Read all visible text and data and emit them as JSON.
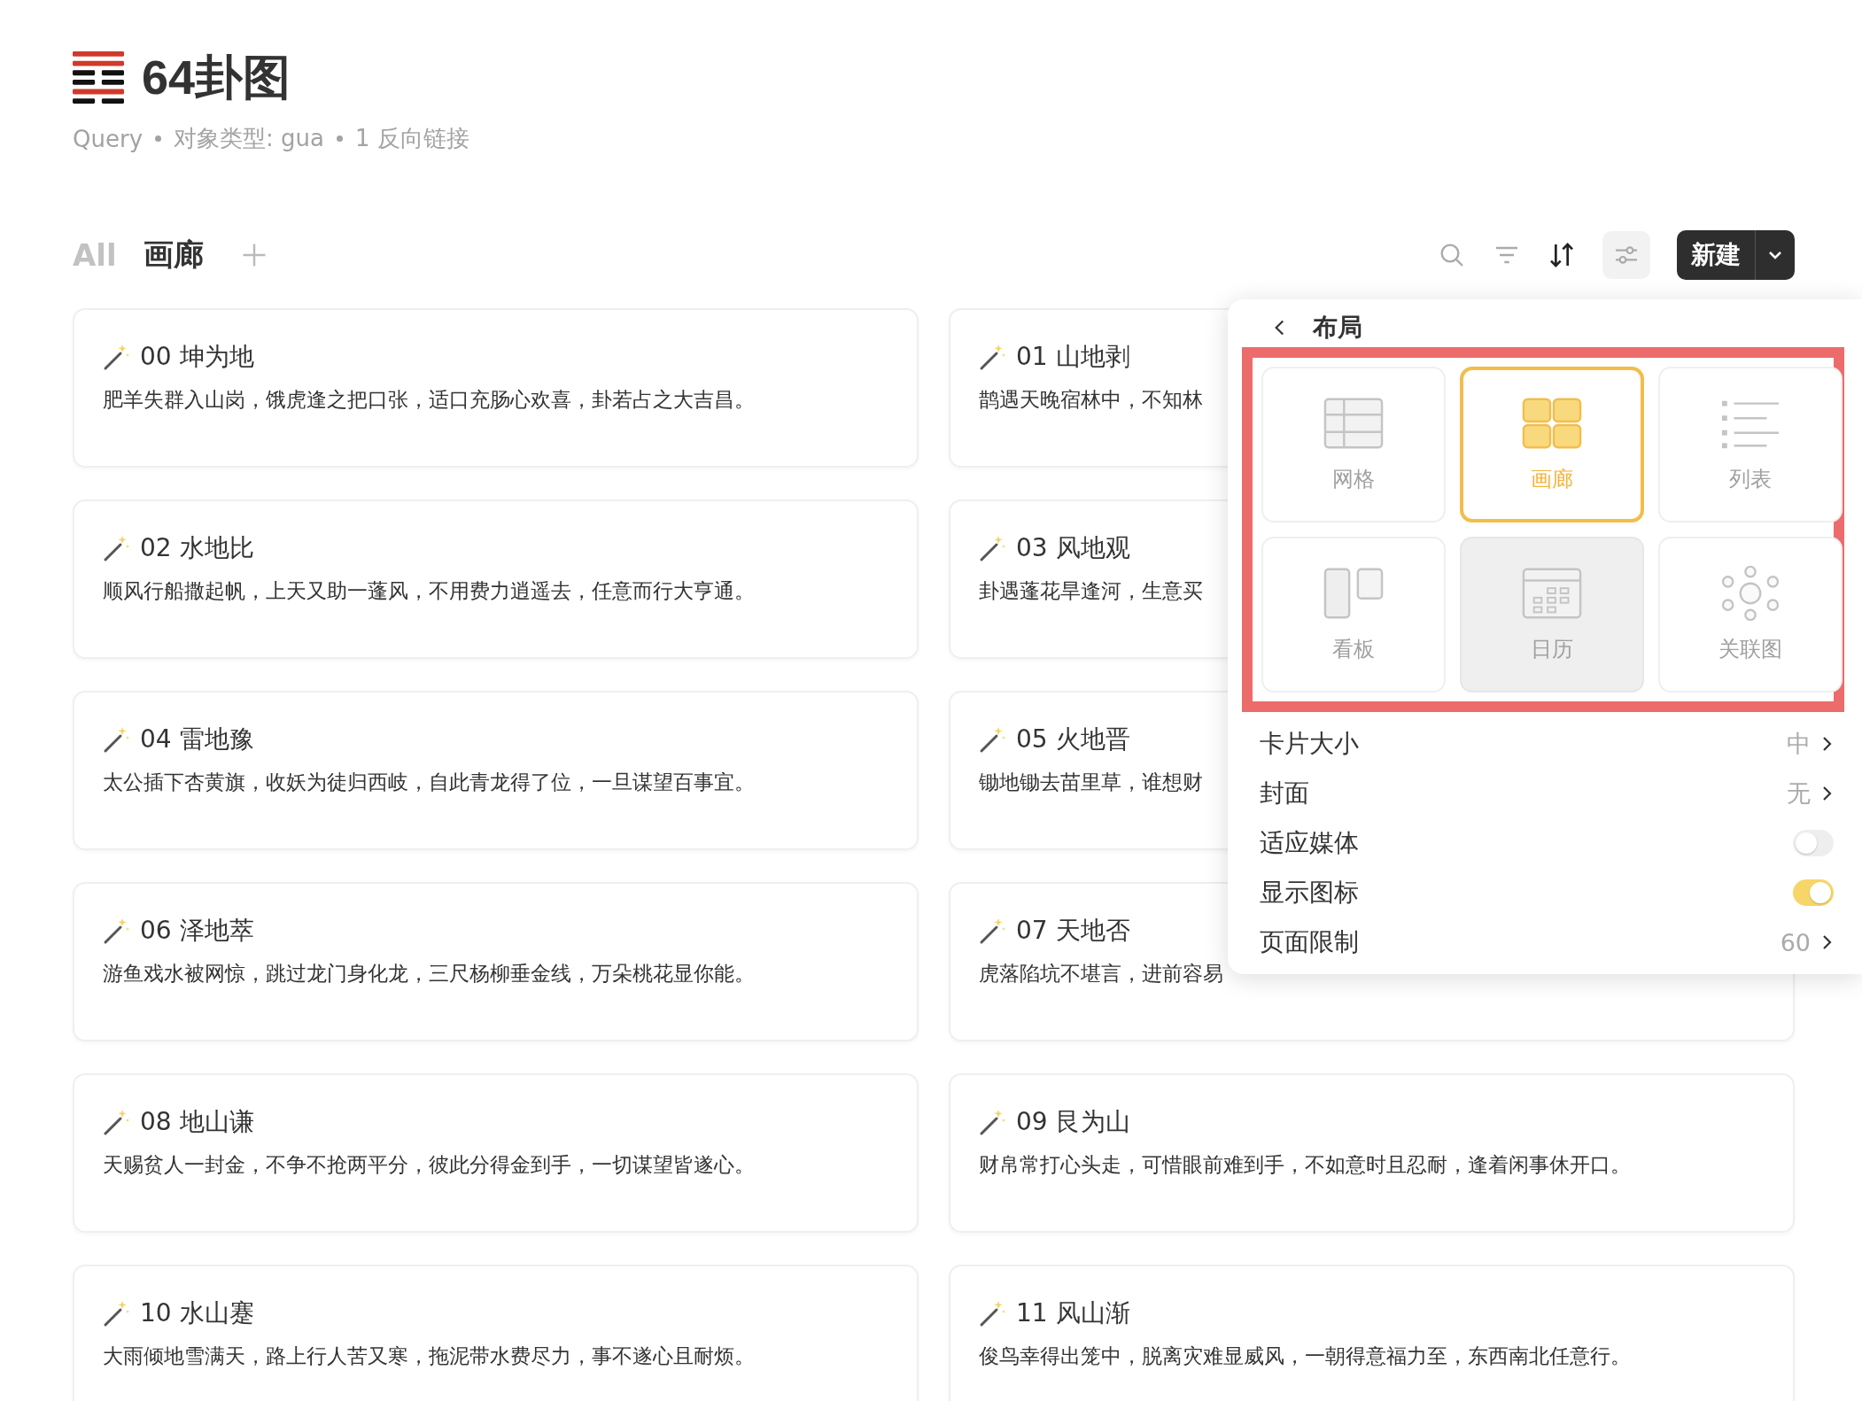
{
  "page": {
    "title": "64卦图",
    "meta": [
      "Query",
      "对象类型: gua",
      "1 反向链接"
    ]
  },
  "views": [
    {
      "label": "All",
      "selected": false
    },
    {
      "label": "画廊",
      "selected": true
    }
  ],
  "toolbar": {
    "new_button": "新建"
  },
  "cards": [
    {
      "title": "00 坤为地",
      "body": "肥羊失群入山岗，饿虎逢之把口张，适口充肠心欢喜，卦若占之大吉昌。"
    },
    {
      "title": "01 山地剥",
      "body": "鹊遇天晚宿林中，不知林"
    },
    {
      "title": "02 水地比",
      "body": "顺风行船撒起帆，上天又助一蓬风，不用费力逍遥去，任意而行大亨通。"
    },
    {
      "title": "03 风地观",
      "body": "卦遇蓬花旱逢河，生意买"
    },
    {
      "title": "04 雷地豫",
      "body": "太公插下杏黄旗，收妖为徒归西岐，自此青龙得了位，一旦谋望百事宜。"
    },
    {
      "title": "05 火地晋",
      "body": "锄地锄去苗里草，谁想财"
    },
    {
      "title": "06 泽地萃",
      "body": "游鱼戏水被网惊，跳过龙门身化龙，三尺杨柳垂金线，万朵桃花显你能。"
    },
    {
      "title": "07 天地否",
      "body": "虎落陷坑不堪言，进前容易"
    },
    {
      "title": "08 地山谦",
      "body": "天赐贫人一封金，不争不抢两平分，彼此分得金到手，一切谋望皆遂心。"
    },
    {
      "title": "09 艮为山",
      "body": "财帛常打心头走，可惜眼前难到手，不如意时且忍耐，逢着闲事休开口。"
    },
    {
      "title": "10 水山蹇",
      "body": "大雨倾地雪满天，路上行人苦又寒，拖泥带水费尽力，事不遂心且耐烦。"
    },
    {
      "title": "11 风山渐",
      "body": "俊鸟幸得出笼中，脱离灾难显威风，一朝得意福力至，东西南北任意行。"
    }
  ],
  "layout_panel": {
    "title": "布局",
    "layouts": [
      {
        "label": "网格",
        "kind": "grid",
        "selected": false,
        "highlighted": false
      },
      {
        "label": "画廊",
        "kind": "gallery",
        "selected": true,
        "highlighted": false
      },
      {
        "label": "列表",
        "kind": "list",
        "selected": false,
        "highlighted": false
      },
      {
        "label": "看板",
        "kind": "board",
        "selected": false,
        "highlighted": false
      },
      {
        "label": "日历",
        "kind": "calendar",
        "selected": false,
        "highlighted": true
      },
      {
        "label": "关联图",
        "kind": "graph",
        "selected": false,
        "highlighted": false
      }
    ],
    "settings": [
      {
        "label": "卡片大小",
        "kind": "value",
        "value": "中"
      },
      {
        "label": "封面",
        "kind": "value",
        "value": "无"
      },
      {
        "label": "适应媒体",
        "kind": "toggle",
        "on": false
      },
      {
        "label": "显示图标",
        "kind": "toggle",
        "on": true
      },
      {
        "label": "页面限制",
        "kind": "value",
        "value": "60"
      }
    ]
  }
}
